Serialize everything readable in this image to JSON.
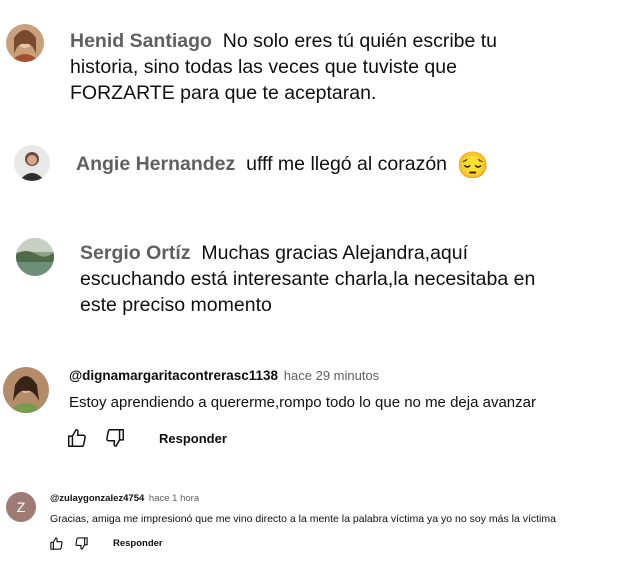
{
  "comments": [
    {
      "author": "Henid Santiago",
      "text": "No solo eres tú quién escribe tu historia, sino todas las veces que tuviste que FORZARTE para que te aceptaran."
    },
    {
      "author": "Angie Hernandez",
      "text": "ufff me llegó al corazón",
      "emoji": "😔"
    },
    {
      "author": "Sergio Ortíz",
      "text": "Muchas gracias Alejandra,aquí escuchando está interesante charla,la necesitaba en este preciso momento"
    },
    {
      "author": "@dignamargaritacontrerasc1138",
      "time": "hace 29 minutos",
      "text": "Estoy aprendiendo a quererme,rompo todo lo que no me deja avanzar",
      "reply_label": "Responder"
    },
    {
      "author": "@zulaygonzalez4754",
      "avatar_letter": "Z",
      "avatar_color": "#9e7b73",
      "time": "hace 1 hora",
      "text": "Gracias, amiga  me impresionó que me vino directo a la mente la palabra víctima ya yo no soy más la víctima",
      "reply_label": "Responder"
    }
  ]
}
